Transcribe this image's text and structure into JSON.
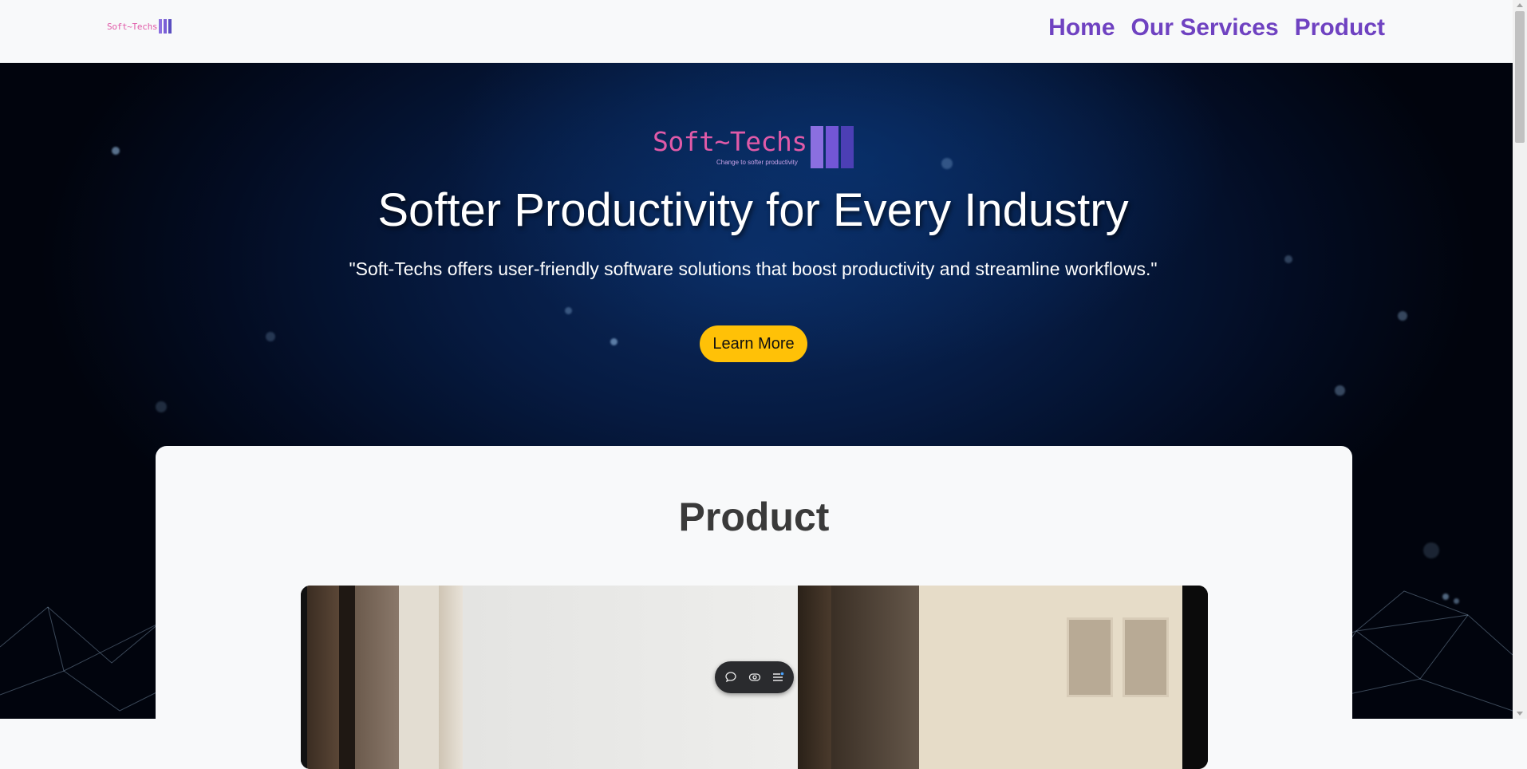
{
  "navbar": {
    "logo_text": "Soft~Techs",
    "links": [
      {
        "label": "Home"
      },
      {
        "label": "Our Services"
      },
      {
        "label": "Product"
      }
    ]
  },
  "hero": {
    "logo_text": "Soft~Techs",
    "logo_tagline": "Change to softer productivity",
    "title": "Softer Productivity for Every Industry",
    "subtitle": "\"Soft-Techs offers user-friendly software solutions that boost productivity and streamline workflows.\"",
    "cta_label": "Learn More"
  },
  "product": {
    "title": "Product"
  },
  "toolbar": {
    "icons": [
      "chat-icon",
      "eye-icon",
      "menu-list-icon"
    ]
  },
  "colors": {
    "brand_purple": "#6f42c1",
    "logo_pink": "#e05aa8",
    "cta_yellow": "#ffc107",
    "hero_navy": "#061b42"
  }
}
